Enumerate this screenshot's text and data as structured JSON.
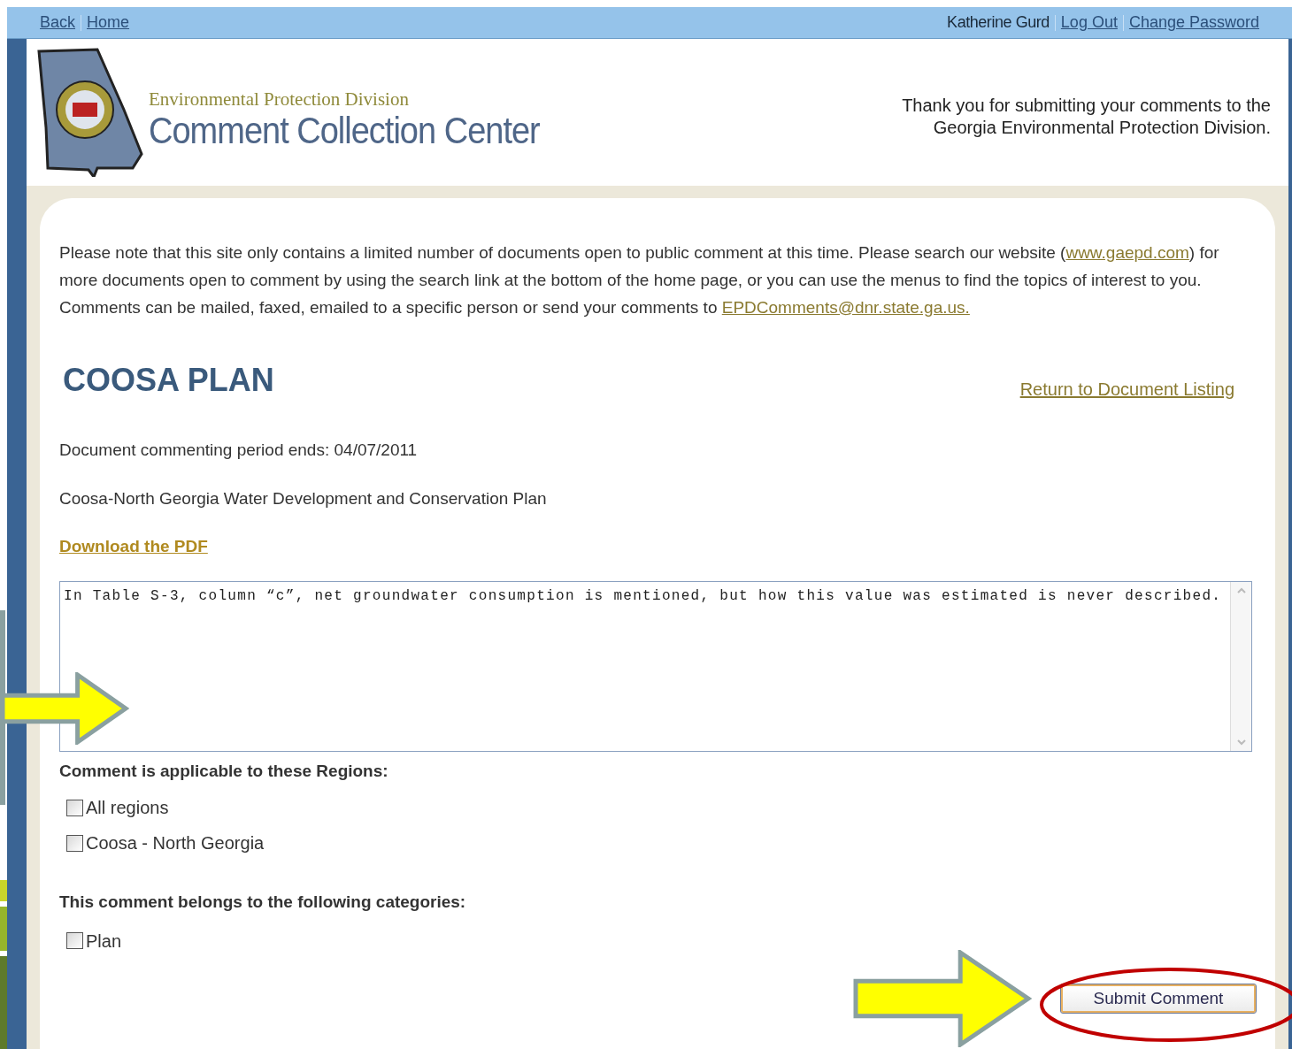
{
  "top_bar": {
    "left_links": [
      "Back",
      "Home"
    ],
    "user_name": "Katherine Gurd",
    "right_links": [
      "Log Out",
      "Change Password"
    ]
  },
  "header": {
    "division": "Environmental Protection Division",
    "title": "Comment Collection Center",
    "thanks": [
      "Thank you for submitting your comments to the",
      "Georgia Environmental Protection Division."
    ]
  },
  "notice": {
    "before": "Please note that this site only contains a limited number of documents open to public comment at this time. Please search our website (",
    "website_link": "www.gaepd.com",
    "middle": ") for more documents open to comment by using the search link at the bottom of the home page, or you can use the menus to find the topics of interest to you. Comments can be mailed, faxed, emailed to a specific person or send your comments to",
    "email_link": "EPDComments@dnr.state.ga.us."
  },
  "document": {
    "title": "COOSA PLAN",
    "return_link": "Return to Document Listing",
    "period": "Document commenting period ends: 04/07/2011",
    "description": "Coosa-North Georgia Water Development and Conservation Plan",
    "download_link": "Download the PDF"
  },
  "comment": {
    "value": "In Table S-3, column “c”, net groundwater consumption is mentioned, but how this value was estimated is never described."
  },
  "regions": {
    "label": "Comment is applicable to these Regions:",
    "options": [
      {
        "label": "All regions",
        "checked": false
      },
      {
        "label": "Coosa - North Georgia",
        "checked": false
      }
    ]
  },
  "categories": {
    "label": "This comment belongs to the following categories:",
    "options": [
      {
        "label": "Plan",
        "checked": false
      }
    ]
  },
  "submit_button": "Submit Comment"
}
